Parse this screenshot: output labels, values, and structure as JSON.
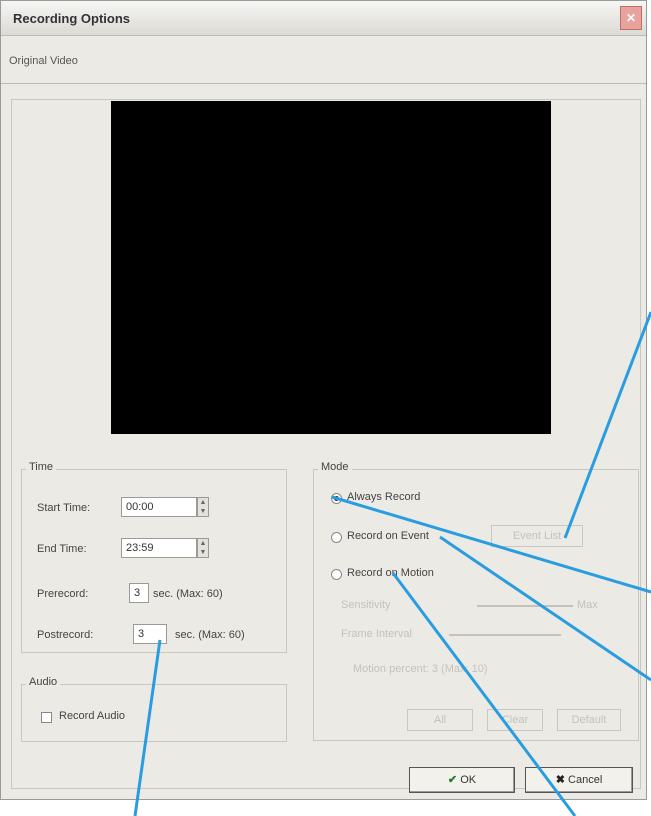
{
  "window": {
    "title": "Recording Options",
    "close_icon": "close-icon"
  },
  "tab": {
    "label": "Original Video"
  },
  "time": {
    "group_label": "Time",
    "start_label": "Start Time:",
    "start_value": "00:00",
    "end_label": "End Time:",
    "end_value": "23:59",
    "prerecord_label": "Prerecord:",
    "prerecord_value": "3",
    "prerecord_unit": "sec. (Max: 60)",
    "postrecord_label": "Postrecord:",
    "postrecord_value": "3",
    "postrecord_unit": "sec. (Max: 60)"
  },
  "audio": {
    "group_label": "Audio",
    "record_audio_label": "Record Audio"
  },
  "mode": {
    "group_label": "Mode",
    "always_record_label": "Always Record",
    "record_on_event_label": "Record on Event",
    "event_button_label": "Event List",
    "record_on_motion_label": "Record on Motion",
    "sensitivity_label": "Sensitivity",
    "sensitivity_suffix": "Max",
    "frame_interval_label": "Frame Interval",
    "motion_percent_label": "Motion percent: 3 (Max: 10)",
    "btn_all": "All",
    "btn_clear": "Clear",
    "btn_default": "Default"
  },
  "footer": {
    "ok_label": "OK",
    "cancel_label": "Cancel"
  },
  "colors": {
    "annotation_line": "#2a9de0",
    "dialog_bg": "#eceae4",
    "video_bg": "#000000"
  }
}
